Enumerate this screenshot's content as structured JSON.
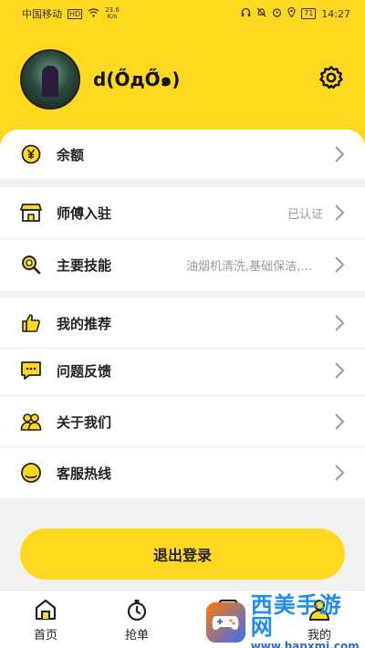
{
  "status_bar": {
    "carrier": "中国移动",
    "carrier_badge": "HD",
    "net_speed_value": "23.6",
    "net_speed_unit": "K/s",
    "battery": "71",
    "time": "14:27"
  },
  "profile": {
    "username": "d(Ő̀дŐ́๑)"
  },
  "menu": {
    "balance": {
      "label": "余额",
      "icon": "yen-coin-icon"
    },
    "master_join": {
      "label": "师傅入驻",
      "value": "已认证",
      "icon": "storefront-icon"
    },
    "skills": {
      "label": "主要技能",
      "value": "油烟机清洗,基础保洁,地暖清洗...",
      "icon": "search-magnifier-icon"
    },
    "recommend": {
      "label": "我的推荐",
      "icon": "thumbs-up-icon"
    },
    "feedback": {
      "label": "问题反馈",
      "icon": "chat-bubble-icon"
    },
    "about": {
      "label": "关于我们",
      "icon": "people-icon"
    },
    "hotline": {
      "label": "客服热线",
      "icon": "headset-circle-icon"
    }
  },
  "logout_label": "退出登录",
  "tabbar": {
    "home": "首页",
    "grab": "抢单",
    "mine": "我的"
  },
  "watermark": {
    "title": "西美手游网",
    "url": "www.hanxmi.com"
  },
  "colors": {
    "accent": "#ffd81f",
    "text": "#222222",
    "muted": "#999999"
  }
}
